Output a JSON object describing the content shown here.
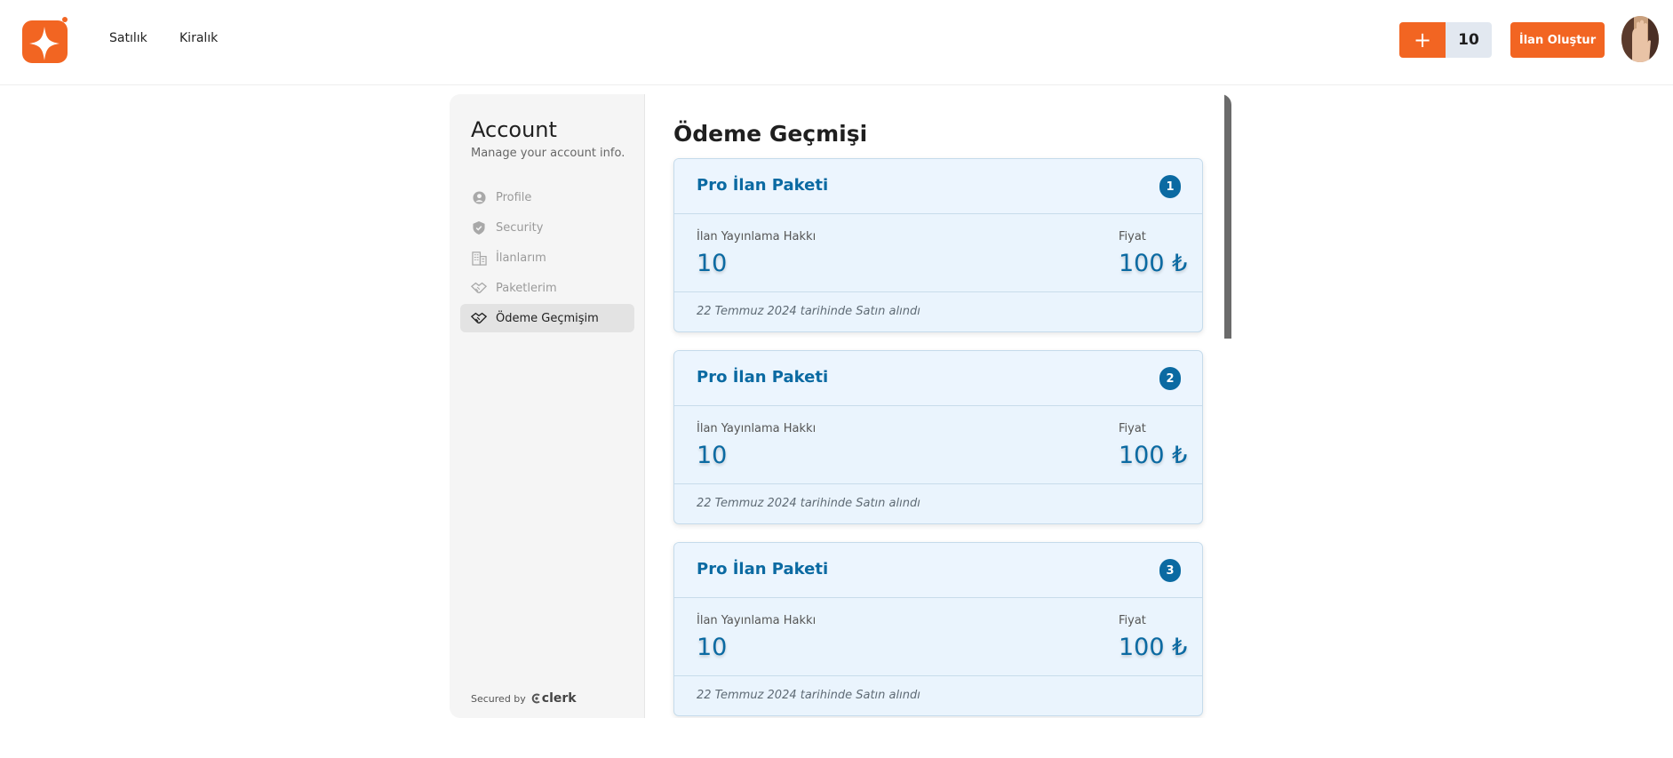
{
  "nav": {
    "links": [
      "Satılık",
      "Kiralık"
    ]
  },
  "header": {
    "plus_icon": "+",
    "credits": "10",
    "create_label": "İlan Oluştur"
  },
  "colors": {
    "brand": "#f26522",
    "accent_blue": "#0b6aa2",
    "card_bg": "#eaf4fd"
  },
  "account": {
    "title": "Account",
    "subtitle": "Manage your account info.",
    "items": [
      {
        "label": "Profile",
        "icon": "user-circle-icon"
      },
      {
        "label": "Security",
        "icon": "shield-check-icon"
      },
      {
        "label": "İlanlarım",
        "icon": "building-icon"
      },
      {
        "label": "Paketlerim",
        "icon": "handshake-icon"
      },
      {
        "label": "Ödeme Geçmişim",
        "icon": "handshake-icon"
      }
    ],
    "active_index": 4,
    "secured_by": "Secured by",
    "clerk": "clerk"
  },
  "payments": {
    "title": "Ödeme Geçmişi",
    "records": [
      {
        "name": "Pro İlan Paketi",
        "index": "1",
        "rights_label": "İlan Yayınlama Hakkı",
        "rights_value": "10",
        "price_label": "Fiyat",
        "price_value": "100 ₺",
        "purchased": "22 Temmuz 2024 tarihinde Satın alındı"
      },
      {
        "name": "Pro İlan Paketi",
        "index": "2",
        "rights_label": "İlan Yayınlama Hakkı",
        "rights_value": "10",
        "price_label": "Fiyat",
        "price_value": "100 ₺",
        "purchased": "22 Temmuz 2024 tarihinde Satın alındı"
      },
      {
        "name": "Pro İlan Paketi",
        "index": "3",
        "rights_label": "İlan Yayınlama Hakkı",
        "rights_value": "10",
        "price_label": "Fiyat",
        "price_value": "100 ₺",
        "purchased": "22 Temmuz 2024 tarihinde Satın alındı"
      }
    ]
  }
}
